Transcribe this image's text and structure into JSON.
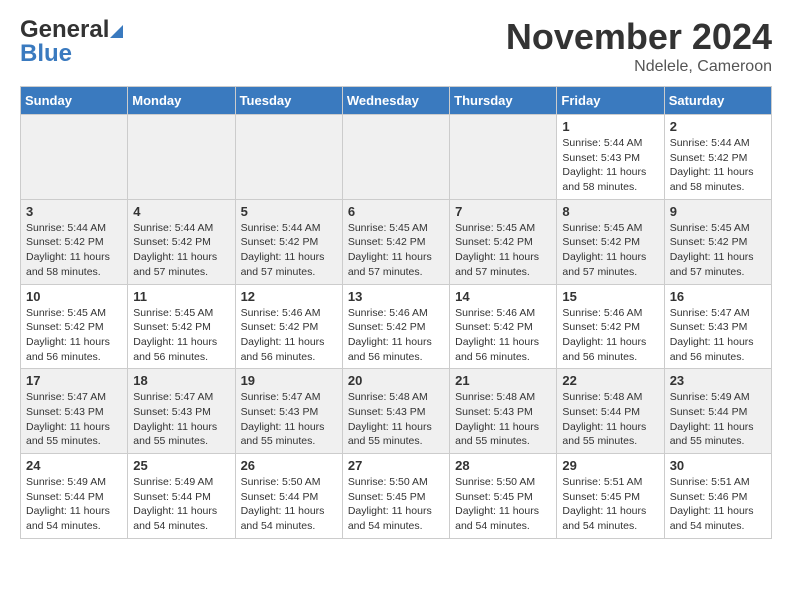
{
  "header": {
    "logo_general": "General",
    "logo_blue": "Blue",
    "month_title": "November 2024",
    "location": "Ndelele, Cameroon"
  },
  "weekdays": [
    "Sunday",
    "Monday",
    "Tuesday",
    "Wednesday",
    "Thursday",
    "Friday",
    "Saturday"
  ],
  "weeks": [
    [
      {
        "day": "",
        "info": ""
      },
      {
        "day": "",
        "info": ""
      },
      {
        "day": "",
        "info": ""
      },
      {
        "day": "",
        "info": ""
      },
      {
        "day": "",
        "info": ""
      },
      {
        "day": "1",
        "info": "Sunrise: 5:44 AM\nSunset: 5:43 PM\nDaylight: 11 hours and 58 minutes."
      },
      {
        "day": "2",
        "info": "Sunrise: 5:44 AM\nSunset: 5:42 PM\nDaylight: 11 hours and 58 minutes."
      }
    ],
    [
      {
        "day": "3",
        "info": "Sunrise: 5:44 AM\nSunset: 5:42 PM\nDaylight: 11 hours and 58 minutes."
      },
      {
        "day": "4",
        "info": "Sunrise: 5:44 AM\nSunset: 5:42 PM\nDaylight: 11 hours and 57 minutes."
      },
      {
        "day": "5",
        "info": "Sunrise: 5:44 AM\nSunset: 5:42 PM\nDaylight: 11 hours and 57 minutes."
      },
      {
        "day": "6",
        "info": "Sunrise: 5:45 AM\nSunset: 5:42 PM\nDaylight: 11 hours and 57 minutes."
      },
      {
        "day": "7",
        "info": "Sunrise: 5:45 AM\nSunset: 5:42 PM\nDaylight: 11 hours and 57 minutes."
      },
      {
        "day": "8",
        "info": "Sunrise: 5:45 AM\nSunset: 5:42 PM\nDaylight: 11 hours and 57 minutes."
      },
      {
        "day": "9",
        "info": "Sunrise: 5:45 AM\nSunset: 5:42 PM\nDaylight: 11 hours and 57 minutes."
      }
    ],
    [
      {
        "day": "10",
        "info": "Sunrise: 5:45 AM\nSunset: 5:42 PM\nDaylight: 11 hours and 56 minutes."
      },
      {
        "day": "11",
        "info": "Sunrise: 5:45 AM\nSunset: 5:42 PM\nDaylight: 11 hours and 56 minutes."
      },
      {
        "day": "12",
        "info": "Sunrise: 5:46 AM\nSunset: 5:42 PM\nDaylight: 11 hours and 56 minutes."
      },
      {
        "day": "13",
        "info": "Sunrise: 5:46 AM\nSunset: 5:42 PM\nDaylight: 11 hours and 56 minutes."
      },
      {
        "day": "14",
        "info": "Sunrise: 5:46 AM\nSunset: 5:42 PM\nDaylight: 11 hours and 56 minutes."
      },
      {
        "day": "15",
        "info": "Sunrise: 5:46 AM\nSunset: 5:42 PM\nDaylight: 11 hours and 56 minutes."
      },
      {
        "day": "16",
        "info": "Sunrise: 5:47 AM\nSunset: 5:43 PM\nDaylight: 11 hours and 56 minutes."
      }
    ],
    [
      {
        "day": "17",
        "info": "Sunrise: 5:47 AM\nSunset: 5:43 PM\nDaylight: 11 hours and 55 minutes."
      },
      {
        "day": "18",
        "info": "Sunrise: 5:47 AM\nSunset: 5:43 PM\nDaylight: 11 hours and 55 minutes."
      },
      {
        "day": "19",
        "info": "Sunrise: 5:47 AM\nSunset: 5:43 PM\nDaylight: 11 hours and 55 minutes."
      },
      {
        "day": "20",
        "info": "Sunrise: 5:48 AM\nSunset: 5:43 PM\nDaylight: 11 hours and 55 minutes."
      },
      {
        "day": "21",
        "info": "Sunrise: 5:48 AM\nSunset: 5:43 PM\nDaylight: 11 hours and 55 minutes."
      },
      {
        "day": "22",
        "info": "Sunrise: 5:48 AM\nSunset: 5:44 PM\nDaylight: 11 hours and 55 minutes."
      },
      {
        "day": "23",
        "info": "Sunrise: 5:49 AM\nSunset: 5:44 PM\nDaylight: 11 hours and 55 minutes."
      }
    ],
    [
      {
        "day": "24",
        "info": "Sunrise: 5:49 AM\nSunset: 5:44 PM\nDaylight: 11 hours and 54 minutes."
      },
      {
        "day": "25",
        "info": "Sunrise: 5:49 AM\nSunset: 5:44 PM\nDaylight: 11 hours and 54 minutes."
      },
      {
        "day": "26",
        "info": "Sunrise: 5:50 AM\nSunset: 5:44 PM\nDaylight: 11 hours and 54 minutes."
      },
      {
        "day": "27",
        "info": "Sunrise: 5:50 AM\nSunset: 5:45 PM\nDaylight: 11 hours and 54 minutes."
      },
      {
        "day": "28",
        "info": "Sunrise: 5:50 AM\nSunset: 5:45 PM\nDaylight: 11 hours and 54 minutes."
      },
      {
        "day": "29",
        "info": "Sunrise: 5:51 AM\nSunset: 5:45 PM\nDaylight: 11 hours and 54 minutes."
      },
      {
        "day": "30",
        "info": "Sunrise: 5:51 AM\nSunset: 5:46 PM\nDaylight: 11 hours and 54 minutes."
      }
    ]
  ]
}
